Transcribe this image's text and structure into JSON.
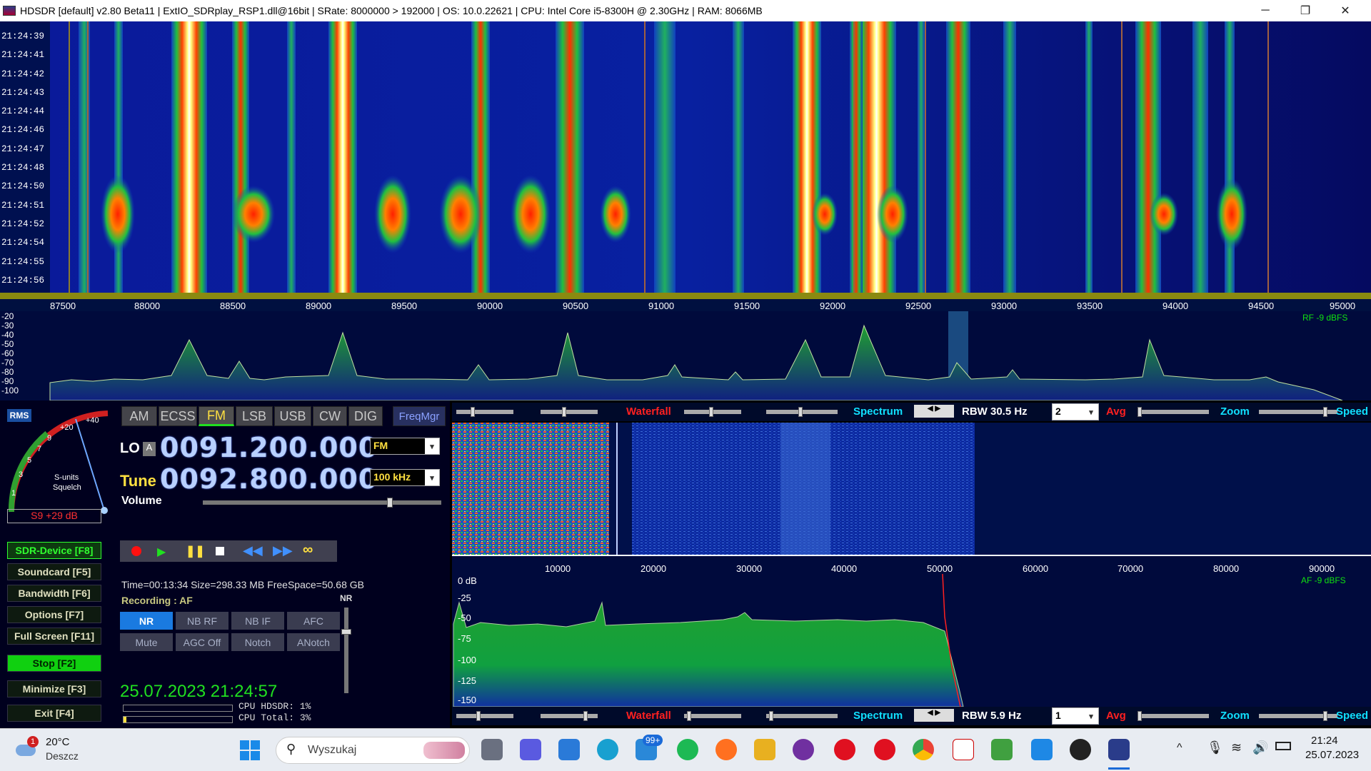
{
  "window": {
    "title": "HDSDR  [default]  v2.80 Beta11  |  ExtIO_SDRplay_RSP1.dll@16bit  |  SRate: 8000000 > 192000  |  OS: 10.0.22621   |  CPU: Intel Core i5-8300H @ 2.30GHz  |  RAM: 8066MB",
    "minimize": "─",
    "restore": "❐",
    "close": "✕"
  },
  "waterfall_times": [
    "21:24:39",
    "21:24:41",
    "21:24:42",
    "21:24:43",
    "21:24:44",
    "21:24:46",
    "21:24:47",
    "21:24:48",
    "21:24:50",
    "21:24:51",
    "21:24:52",
    "21:24:54",
    "21:24:55",
    "21:24:56"
  ],
  "rf_axis": {
    "ticks": [
      "87500",
      "88000",
      "88500",
      "89000",
      "89500",
      "90000",
      "90500",
      "91000",
      "91500",
      "92000",
      "92500",
      "93000",
      "93500",
      "94000",
      "94500",
      "95000"
    ]
  },
  "rf_spectrum": {
    "db_labels": [
      "-20",
      "-30",
      "-40",
      "-50",
      "-60",
      "-70",
      "-80",
      "-90",
      "-100"
    ],
    "level": "RF  -9 dBFS"
  },
  "top_controls": {
    "waterfall": "Waterfall",
    "spectrum": "Spectrum",
    "rbw": "RBW 30.5 Hz",
    "avg_value": "2",
    "avg": "Avg",
    "zoom": "Zoom",
    "speed": "Speed"
  },
  "bottom_controls": {
    "waterfall": "Waterfall",
    "spectrum": "Spectrum",
    "rbw": "RBW  5.9 Hz",
    "avg_value": "1",
    "avg": "Avg",
    "zoom": "Zoom",
    "speed": "Speed"
  },
  "smeter": {
    "rms": "RMS",
    "units": "S-units",
    "squelch": "Squelch",
    "reading": "S9 +29 dB",
    "scale": [
      "1",
      "3",
      "5",
      "7",
      "9",
      "+20",
      "+40"
    ]
  },
  "modes": [
    "AM",
    "ECSS",
    "FM",
    "LSB",
    "USB",
    "CW",
    "DIG"
  ],
  "active_mode": "FM",
  "freqmgr": "FreqMgr",
  "lo": {
    "label": "LO",
    "badge": "A",
    "value": "0091.200.000",
    "mode_select": "FM"
  },
  "tune": {
    "label": "Tune",
    "value": "0092.800.000",
    "step_select": "100 kHz"
  },
  "volume_label": "Volume",
  "side_buttons": [
    {
      "label": "SDR-Device  [F8]"
    },
    {
      "label": "Soundcard   [F5]"
    },
    {
      "label": "Bandwidth  [F6]"
    },
    {
      "label": "Options     [F7]"
    },
    {
      "label": "Full Screen  [F11]"
    },
    {
      "label": "Stop        [F2]"
    },
    {
      "label": "Minimize   [F3]"
    },
    {
      "label": "Exit         [F4]"
    }
  ],
  "recording": {
    "info": "Time=00:13:34  Size=298.33 MB  FreeSpace=50.68 GB",
    "status": "Recording : AF"
  },
  "nr_label": "NR",
  "dsp_row1": [
    "NR",
    "NB RF",
    "NB IF",
    "AFC"
  ],
  "dsp_row2": [
    "Mute",
    "AGC Off",
    "Notch",
    "ANotch"
  ],
  "datetime": "25.07.2023 21:24:57",
  "cpu": {
    "hdsdr": "CPU HDSDR:  1%",
    "total": "CPU Total:  3%"
  },
  "af_axis": {
    "ticks": [
      "10000",
      "20000",
      "30000",
      "40000",
      "50000",
      "60000",
      "70000",
      "80000",
      "90000"
    ]
  },
  "af_spectrum": {
    "db_labels": [
      "0 dB",
      "-25",
      "-50",
      "-75",
      "-100",
      "-125",
      "-150"
    ],
    "level": "AF  -9 dBFS"
  },
  "taskbar": {
    "weather_temp": "20°C",
    "weather_desc": "Deszcz",
    "weather_badge": "1",
    "search_placeholder": "Wyszukaj",
    "mail_badge": "99+",
    "time": "21:24",
    "date": "25.07.2023"
  },
  "colors": {
    "accent_green": "#10e010",
    "freq_digits": "#b8d0ff",
    "tune_label": "#ffe040",
    "waterfall_red": "#ff2020",
    "spectrum_cyan": "#10e0ff"
  }
}
